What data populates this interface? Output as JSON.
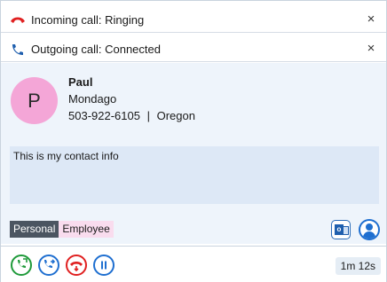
{
  "calls": [
    {
      "status": "Incoming call: Ringing",
      "icon": "hangup-phone-icon",
      "icon_color": "#e02020",
      "close": "×"
    },
    {
      "status": "Outgoing call: Connected",
      "icon": "phone-icon",
      "icon_color": "#1f5fae",
      "close": "×"
    }
  ],
  "contact": {
    "avatar_letter": "P",
    "avatar_color": "#f4a6d7",
    "name": "Paul",
    "company": "Mondago",
    "phone": "503-922-6105",
    "separator": "|",
    "region": "Oregon",
    "note": "This is my contact info"
  },
  "tags": [
    {
      "label": "Personal",
      "color": "#4b5561"
    },
    {
      "label": "Employee",
      "color": "#f9dcee"
    }
  ],
  "actions": {
    "outlook_icon": "outlook-icon",
    "contact_icon": "contact-person-icon"
  },
  "toolbar": {
    "buttons": [
      {
        "name": "answer-button",
        "icon": "answer-call-icon",
        "color": "#1f9a3a"
      },
      {
        "name": "transfer-button",
        "icon": "transfer-call-icon",
        "color": "#1f6fd0"
      },
      {
        "name": "hangup-button",
        "icon": "hangup-call-icon",
        "color": "#e02020"
      },
      {
        "name": "hold-button",
        "icon": "pause-icon",
        "color": "#1f6fd0"
      }
    ],
    "timer": "1m 12s"
  }
}
